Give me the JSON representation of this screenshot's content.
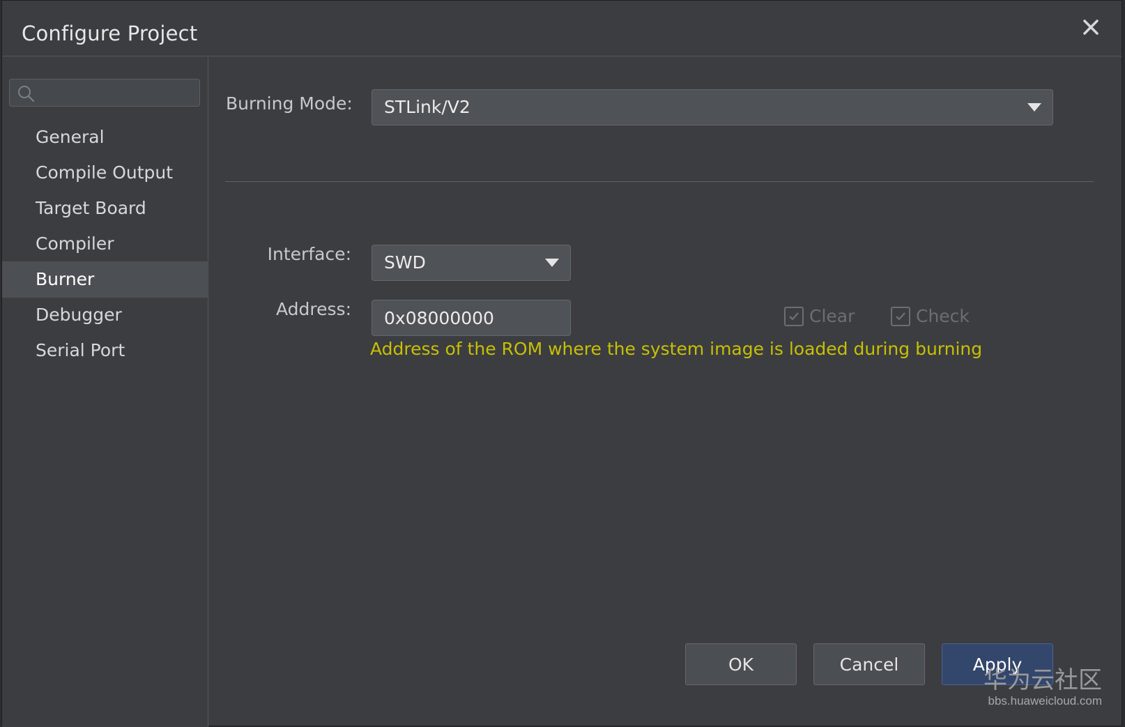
{
  "dialog": {
    "title": "Configure Project",
    "close_icon": "close-icon"
  },
  "sidebar": {
    "search": {
      "placeholder": "",
      "value": "",
      "icon": "search-icon"
    },
    "items": [
      {
        "label": "General",
        "active": false
      },
      {
        "label": "Compile Output",
        "active": false
      },
      {
        "label": "Target Board",
        "active": false
      },
      {
        "label": "Compiler",
        "active": false
      },
      {
        "label": "Burner",
        "active": true
      },
      {
        "label": "Debugger",
        "active": false
      },
      {
        "label": "Serial Port",
        "active": false
      }
    ]
  },
  "burner": {
    "burning_mode": {
      "label": "Burning Mode:",
      "value": "STLink/V2"
    },
    "interface": {
      "label": "Interface:",
      "value": "SWD"
    },
    "address": {
      "label": "Address:",
      "value": "0x08000000",
      "hint": "Address of the ROM where the system image is loaded during burning"
    },
    "clear": {
      "label": "Clear",
      "checked": true,
      "enabled": false
    },
    "check": {
      "label": "Check",
      "checked": true,
      "enabled": false
    }
  },
  "buttons": {
    "ok": "OK",
    "cancel": "Cancel",
    "apply": "Apply"
  },
  "watermark": {
    "line1": "华为云社区",
    "line2": "bbs.huaweicloud.com"
  },
  "colors": {
    "background": "#3b3d41",
    "active_item": "#4c5055",
    "hint": "#c8c000",
    "primary_button": "#33466c"
  }
}
